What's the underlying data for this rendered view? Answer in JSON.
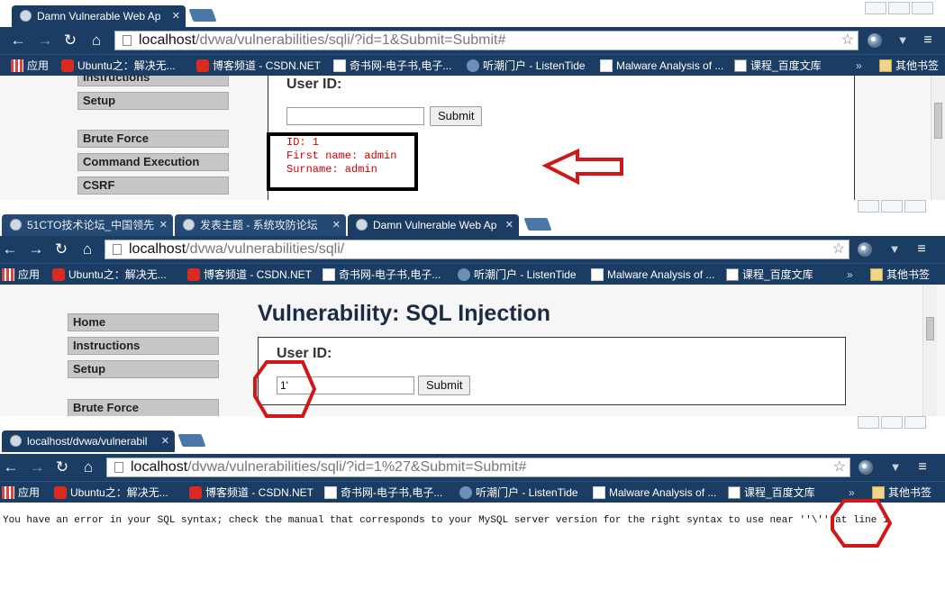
{
  "panel1": {
    "tab_title": "Damn Vulnerable Web Ap",
    "url_host": "localhost",
    "url_path": "/dvwa/vulnerabilities/sqli/?id=1&Submit=Submit#",
    "sidebar": [
      "Instructions",
      "Setup",
      "Brute Force",
      "Command Execution",
      "CSRF"
    ],
    "user_id_label": "User ID:",
    "input_value": "",
    "submit_label": "Submit",
    "result_lines": [
      "ID: 1",
      "First name: admin",
      "Surname: admin"
    ]
  },
  "panel2": {
    "tabs": [
      "51CTO技术论坛_中国领先",
      "发表主题 - 系统攻防论坛",
      "Damn Vulnerable Web Ap"
    ],
    "url_host": "localhost",
    "url_path": "/dvwa/vulnerabilities/sqli/",
    "sidebar": [
      "Home",
      "Instructions",
      "Setup",
      "Brute Force"
    ],
    "heading": "Vulnerability: SQL Injection",
    "user_id_label": "User ID:",
    "input_value": "1'",
    "submit_label": "Submit"
  },
  "panel3": {
    "tab_title": "localhost/dvwa/vulnerabil",
    "url_host": "localhost",
    "url_path": "/dvwa/vulnerabilities/sqli/?id=1%27&Submit=Submit#",
    "error_text": "You have an error in your SQL syntax; check the manual that corresponds to your MySQL server version for the right syntax to use near ''\\'' at line 1"
  },
  "bookmarks": {
    "apps": "应用",
    "ubuntu": "Ubuntu之：解决无...",
    "csdn": "博客频道 - CSDN.NET",
    "qishu": "奇书网-电子书,电子...",
    "tide": "听潮门户 - ListenTide",
    "malware": "Malware Analysis of ...",
    "baidu": "课程_百度文库",
    "more": "»",
    "other": "其他书签"
  },
  "icons": {
    "back": "back-arrow-icon",
    "forward": "forward-arrow-icon",
    "reload": "reload-icon",
    "home": "home-icon",
    "star": "star-icon",
    "menu": "hamburger-menu-icon"
  },
  "colors": {
    "chrome_frame": "#1b3d64",
    "annotation": "#d01818",
    "result_text": "#cc0000"
  }
}
